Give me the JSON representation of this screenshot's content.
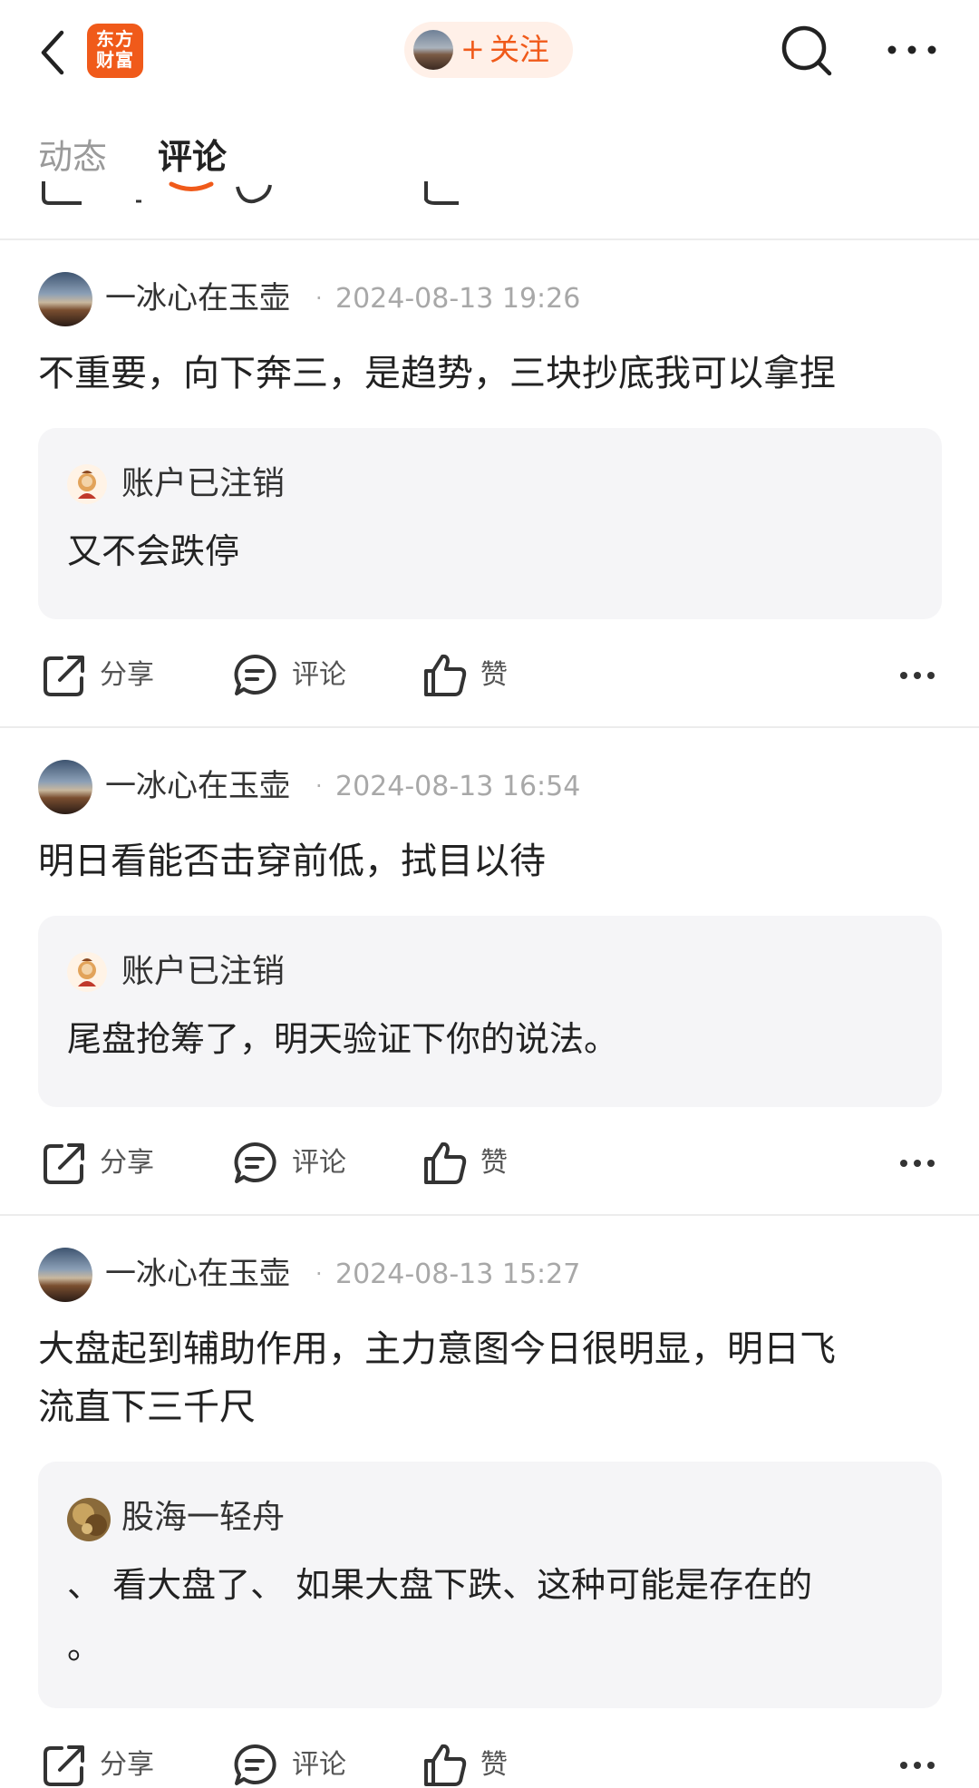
{
  "header": {
    "logo_line1": "东方",
    "logo_line2": "财富",
    "follow_plus": "+",
    "follow_label": "关注",
    "icons": [
      "back-icon",
      "search-icon",
      "more-icon"
    ]
  },
  "tabs": [
    {
      "label": "动态",
      "active": false
    },
    {
      "label": "评论",
      "active": true
    }
  ],
  "accent_color": "#f05a1a",
  "comments": [
    {
      "author": "一冰心在玉壶",
      "separator": "·",
      "time": "2024-08-13 19:26",
      "text": "不重要，向下奔三，是趋势，三块抄底我可以拿捏",
      "reply": {
        "author": "账户已注销",
        "text": "又不会跌停"
      },
      "actions": {
        "share": "分享",
        "comment": "评论",
        "like": "赞"
      }
    },
    {
      "author": "一冰心在玉壶",
      "separator": "·",
      "time": "2024-08-13 16:54",
      "text": "明日看能否击穿前低，拭目以待",
      "reply": {
        "author": "账户已注销",
        "text": "尾盘抢筹了，明天验证下你的说法。"
      },
      "actions": {
        "share": "分享",
        "comment": "评论",
        "like": "赞"
      }
    },
    {
      "author": "一冰心在玉壶",
      "separator": "·",
      "time": "2024-08-13 15:27",
      "text_line1": "大盘起到辅助作用，主力意图今日很明显，明日飞",
      "text_line2": "流直下三千尺",
      "reply": {
        "author": "股海一轻舟",
        "text_line1": "、 看大盘了、 如果大盘下跌、这种可能是存在的",
        "text_line2": "。"
      },
      "actions": {
        "share": "分享",
        "comment": "评论",
        "like": "赞"
      }
    }
  ]
}
